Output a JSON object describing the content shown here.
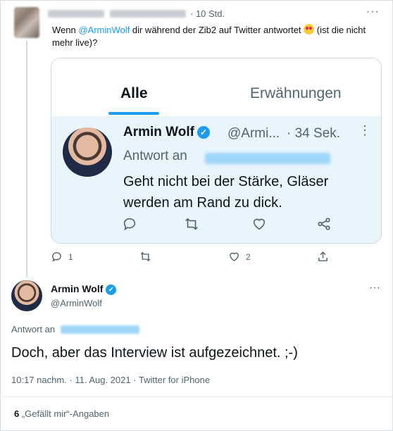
{
  "top_tweet": {
    "time": "· 10 Std.",
    "more": "···",
    "text_before": "Wenn ",
    "mention": "@ArminWolf",
    "text_after": " dir während der Zib2 auf Twitter antwortet ",
    "emoji": "heart-eyes-emoji",
    "text_end": " (ist die nicht mehr live)?",
    "actions": {
      "reply_count": "1",
      "retweet_count": "",
      "like_count": "2",
      "share_count": ""
    }
  },
  "card": {
    "tabs": [
      "Alle",
      "Erwähnungen"
    ],
    "active_tab": 0,
    "name": "Armin Wolf",
    "verified": "✓",
    "handle": "@Armi...",
    "time": "· 34 Sek.",
    "more": "⋮",
    "reply_label": "Antwort an",
    "text": "Geht nicht bei der Stärke, Gläser werden am Rand zu dick.",
    "action_icons": [
      "reply-icon",
      "retweet-icon",
      "like-icon",
      "share-icon"
    ]
  },
  "reply_tweet": {
    "name": "Armin Wolf",
    "verified": "✓",
    "handle": "@ArminWolf",
    "more": "···",
    "reply_label": "Antwort an",
    "text": "Doch, aber das Interview ist aufgezeichnet. ;-)",
    "meta": "10:17 nachm. · 11. Aug. 2021 · Twitter for iPhone",
    "likes_count": "6",
    "likes_label": " „Gefällt mir“-Angaben"
  },
  "colors": {
    "accent": "#1d9bf0",
    "text": "#0f1419",
    "muted": "#536471",
    "card_bg": "#e8f5fd"
  }
}
